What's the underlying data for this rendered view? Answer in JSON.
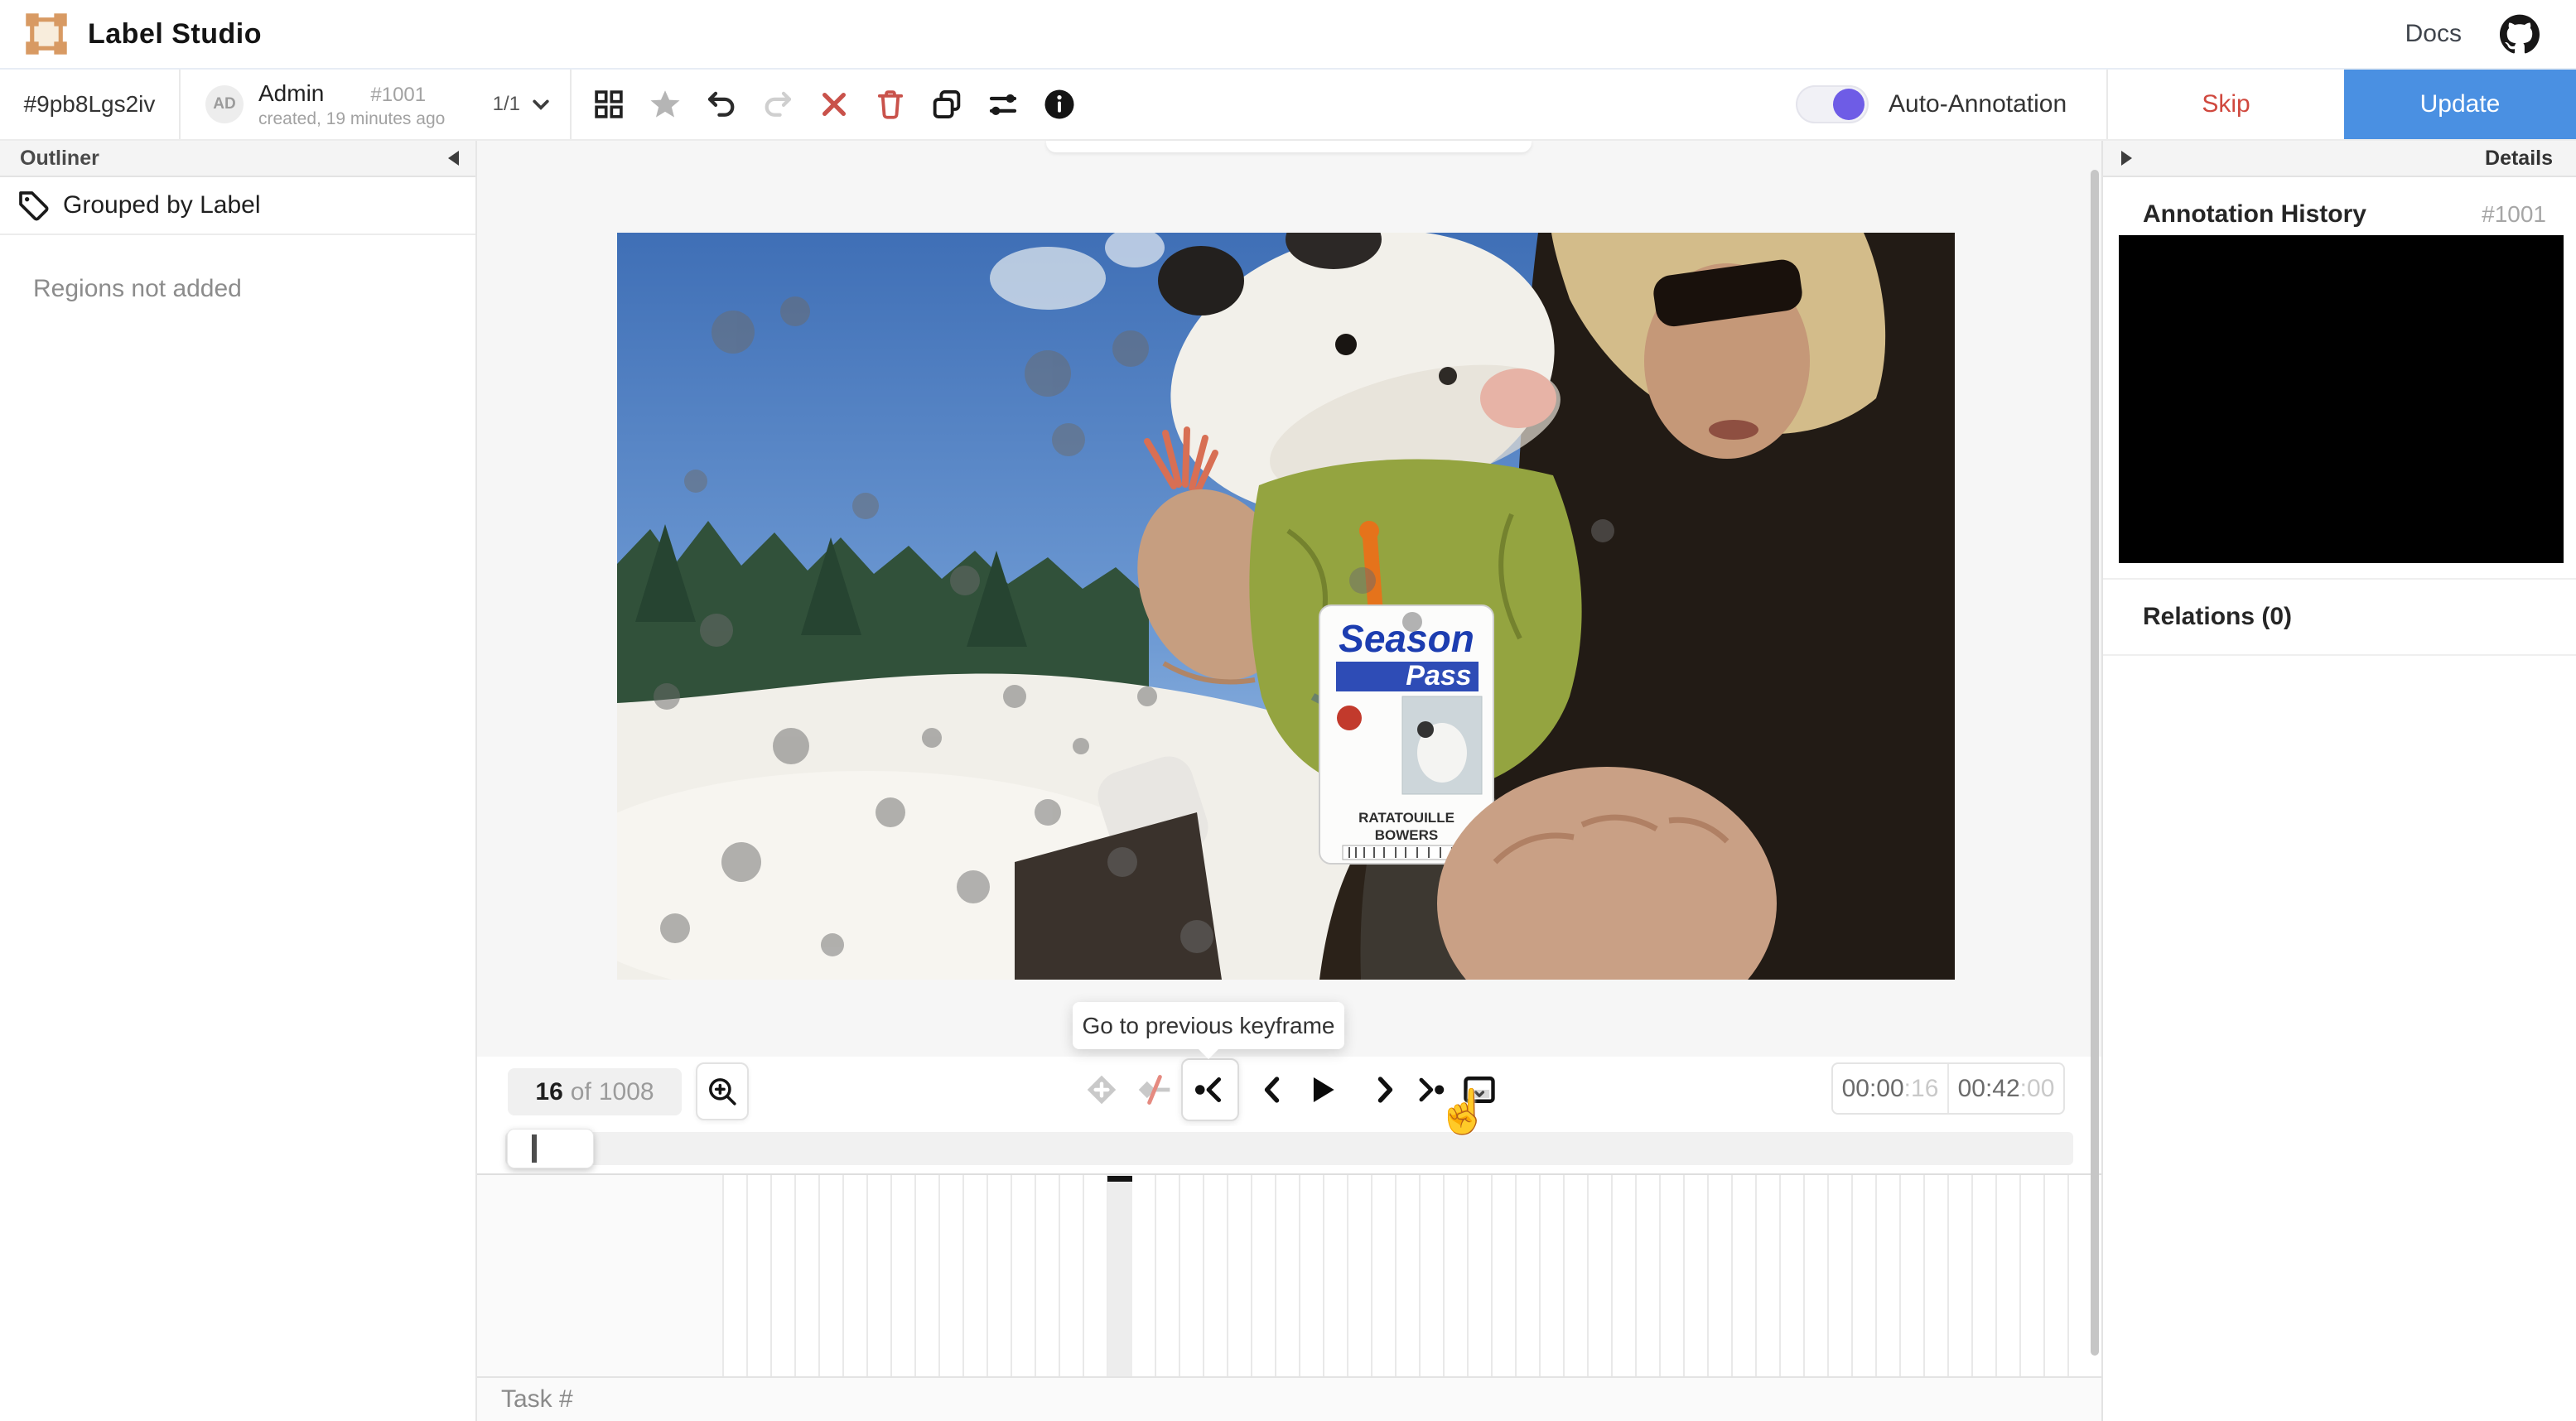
{
  "header": {
    "app_title": "Label Studio",
    "docs_label": "Docs"
  },
  "taskbar": {
    "task_id": "#9pb8Lgs2iv",
    "avatar_initials": "AD",
    "user_name": "Admin",
    "annotation_id": "#1001",
    "created_text": "created, 19 minutes ago",
    "pager": "1/1"
  },
  "actions": {
    "auto_annotation_label": "Auto-Annotation",
    "skip_label": "Skip",
    "update_label": "Update"
  },
  "outliner": {
    "title": "Outliner",
    "grouped_by_label": "Grouped by Label",
    "empty_message": "Regions not added"
  },
  "details": {
    "title": "Details",
    "annotation_history_title": "Annotation History",
    "annotation_id": "#1001",
    "relations_title": "Relations (0)"
  },
  "player": {
    "frame_current": "16",
    "frame_separator": "of",
    "frame_total": "1008",
    "tooltip_text": "Go to previous keyframe",
    "position_time": "00:00",
    "position_frames": ":16",
    "duration_time": "00:42",
    "duration_frames": ":00"
  },
  "timeline": {
    "task_label": "Task #"
  },
  "photo_badge": {
    "line1": "Season",
    "line2": "Pass",
    "name1": "RATATOUILLE",
    "name2": "BOWERS"
  },
  "icons": {
    "cursor_hand_glyph": "☝",
    "toolbar": [
      "grid-view-icon",
      "star-icon",
      "undo-icon",
      "redo-icon",
      "reject-icon",
      "delete-icon",
      "duplicate-icon",
      "settings-icon",
      "info-icon"
    ],
    "player": [
      "zoom-in-icon",
      "add-keyframe-icon",
      "interpolation-icon",
      "prev-keyframe-icon",
      "prev-frame-icon",
      "play-icon",
      "next-frame-icon",
      "next-keyframe-icon",
      "frame-options-icon"
    ]
  },
  "colors": {
    "accent_blue": "#4a90e2",
    "danger_red": "#d0483e",
    "icon_red": "#c9524b",
    "toggle_purple": "#6e5ce6",
    "logo_orange": "#d89a63"
  }
}
